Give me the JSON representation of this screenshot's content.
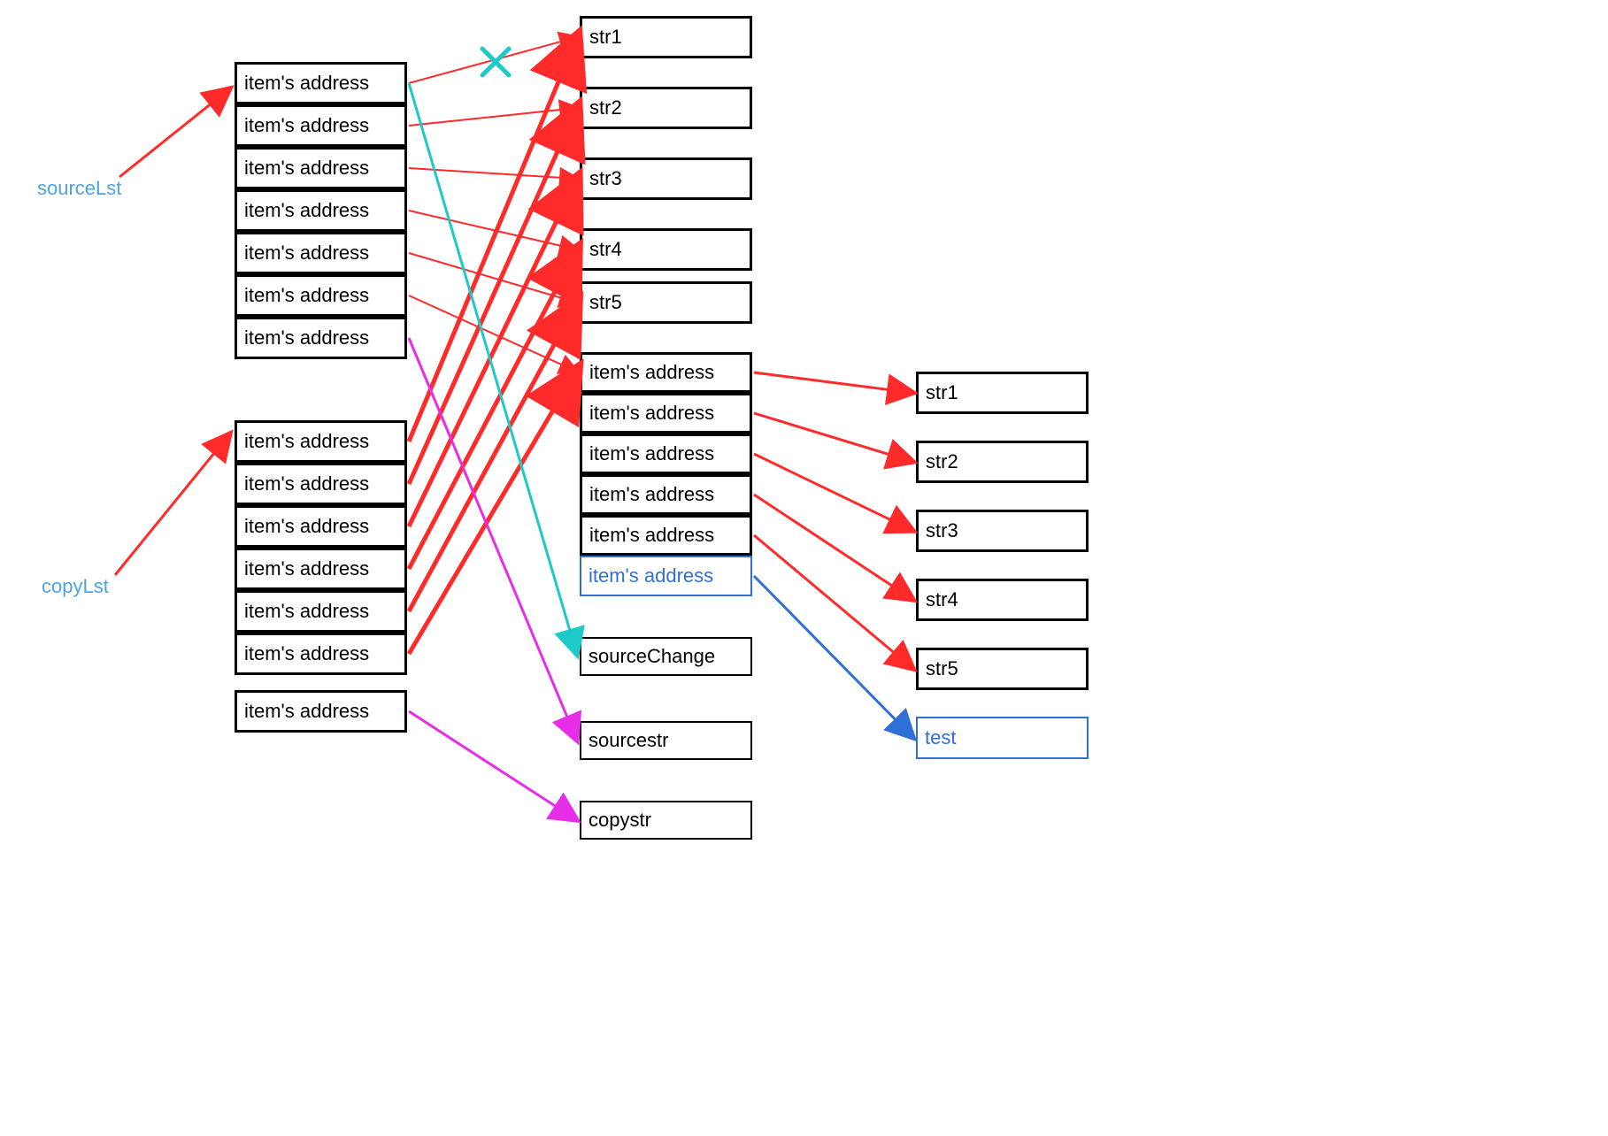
{
  "labels": {
    "sourceLst": "sourceLst",
    "copyLst": "copyLst"
  },
  "itemText": "item's address",
  "sourceList": [
    "item's address",
    "item's address",
    "item's address",
    "item's address",
    "item's address",
    "item's address",
    "item's address"
  ],
  "copyList": [
    "item's address",
    "item's address",
    "item's address",
    "item's address",
    "item's address",
    "item's address",
    "item's address"
  ],
  "strBoxes": [
    "str1",
    "str2",
    "str3",
    "str4",
    "str5"
  ],
  "nestedList": [
    "item's address",
    "item's address",
    "item's address",
    "item's address",
    "item's address",
    "item's address"
  ],
  "sourceChange": "sourceChange",
  "sourcestr": "sourcestr",
  "copystr": "copystr",
  "rightStrBoxes": [
    "str1",
    "str2",
    "str3",
    "str4",
    "str5"
  ],
  "testBox": "test",
  "colors": {
    "red": "#ff2a2a",
    "cyan": "#1ec9c9",
    "magenta": "#e62ee6",
    "blue": "#2f6fd8",
    "labelBlue": "#4ea3e0"
  },
  "notes": [
    "Diagram showing shallow copy of a list: sourceLst and copyLst hold item addresses pointing to shared str1..str5 objects.",
    "sourceLst first item originally pointed to str1 (now broken, cyan X) and is redirected to sourceChange (cyan arrow).",
    "One sourceLst slot points to a nested list of item addresses (red thick arrow), which in turn points to str1..str5 on the right; an extra slot (blue) points to new 'test' box.",
    "The two extra string rows sourcestr and copystr are targets of magenta arrows from sourceLst[6] and copyLst[6]."
  ]
}
